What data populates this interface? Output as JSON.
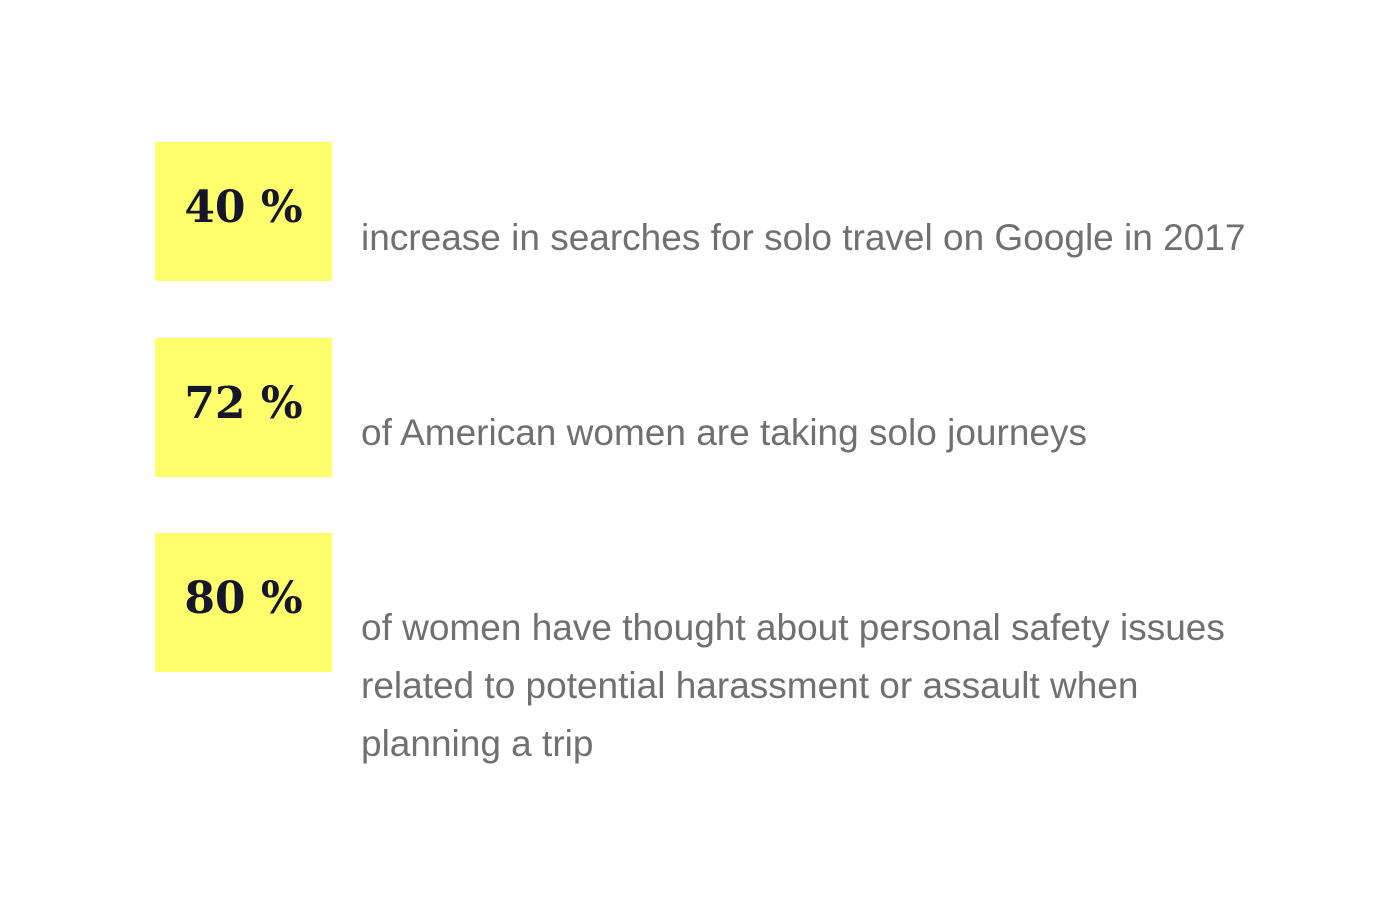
{
  "stats": [
    {
      "value": "40 %",
      "description": "increase in searches for solo travel on Google in 2017"
    },
    {
      "value": "72 %",
      "description": "of American women are taking solo journeys"
    },
    {
      "value": "80 %",
      "description": "of women have thought about personal safety issues related to potential harassment or assault when planning a trip"
    }
  ],
  "colors": {
    "box_background": "#ffff6e",
    "value_text": "#15152b",
    "description_text": "#707070",
    "page_background": "#ffffff"
  }
}
